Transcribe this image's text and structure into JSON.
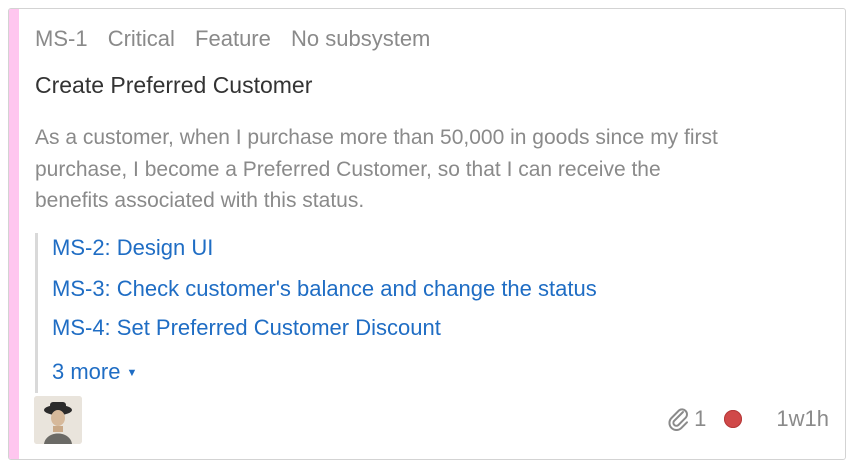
{
  "card": {
    "key": "MS-1",
    "priority": "Critical",
    "type": "Feature",
    "subsystem": "No subsystem",
    "title": "Create Preferred Customer",
    "description_lines": [
      "As a customer, when I purchase more than 50,000 in goods since my first",
      "purchase, I become a Preferred Customer, so that I can receive the",
      "benefits associated with this status."
    ],
    "subtasks": [
      "MS-2: Design UI",
      "MS-3: Check customer's balance and change the status",
      "MS-4: Set Preferred Customer Discount"
    ],
    "more_label": "3 more",
    "attachments_count": "1",
    "estimate": "1w1h",
    "colors": {
      "stripe": "#ffc6ef",
      "link": "#1f6dc4",
      "status": "#d04949"
    },
    "icons": [
      "paperclip-icon",
      "chevron-down-icon",
      "status-dot-icon",
      "avatar"
    ]
  }
}
